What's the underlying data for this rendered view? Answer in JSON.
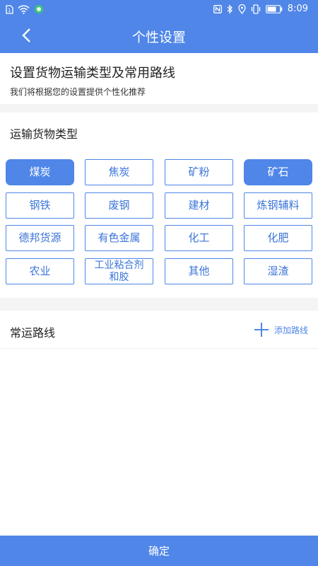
{
  "status_bar": {
    "time": "8:09",
    "left_icons": [
      "sim-icon",
      "wifi-icon",
      "app-notification-icon"
    ],
    "right_icons": [
      "nfc-icon",
      "bluetooth-icon",
      "location-icon",
      "vibrate-icon",
      "battery-icon"
    ]
  },
  "header": {
    "title": "个性设置"
  },
  "intro": {
    "title": "设置货物运输类型及常用路线",
    "subtitle": "我们将根据您的设置提供个性化推荐"
  },
  "cargo": {
    "title": "运输货物类型",
    "options": [
      {
        "label": "煤炭",
        "selected": true
      },
      {
        "label": "焦炭",
        "selected": false
      },
      {
        "label": "矿粉",
        "selected": false
      },
      {
        "label": "矿石",
        "selected": true
      },
      {
        "label": "钢铁",
        "selected": false
      },
      {
        "label": "废钢",
        "selected": false
      },
      {
        "label": "建材",
        "selected": false
      },
      {
        "label": "炼钢辅料",
        "selected": false
      },
      {
        "label": "德邦货源",
        "selected": false
      },
      {
        "label": "有色金属",
        "selected": false
      },
      {
        "label": "化工",
        "selected": false
      },
      {
        "label": "化肥",
        "selected": false
      },
      {
        "label": "农业",
        "selected": false
      },
      {
        "label": "工业粘合剂和胶",
        "selected": false
      },
      {
        "label": "其他",
        "selected": false
      },
      {
        "label": "湿渣",
        "selected": false
      }
    ]
  },
  "routes": {
    "title": "常运路线",
    "add_label": "添加路线"
  },
  "footer": {
    "confirm_label": "确定"
  },
  "colors": {
    "primary": "#4f86e8",
    "background": "#f4f4f4"
  }
}
